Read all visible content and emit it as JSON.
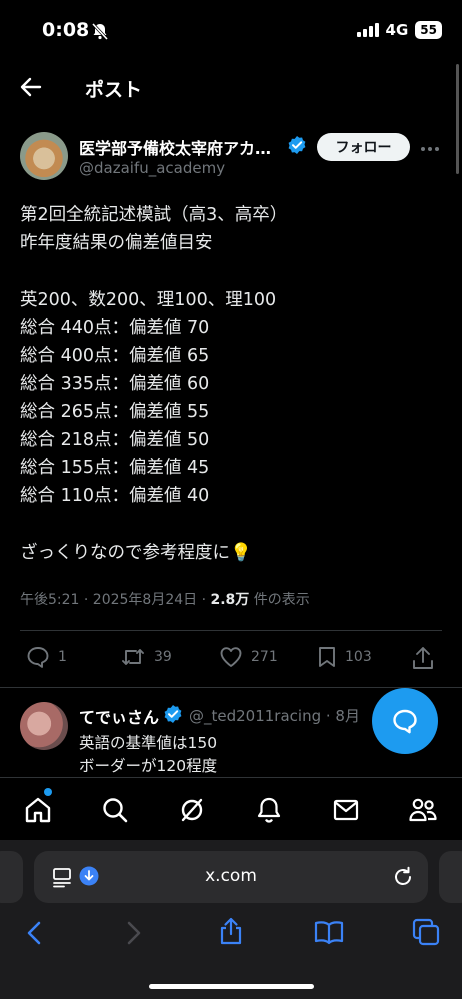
{
  "status": {
    "time": "0:08",
    "network": "4G",
    "battery": "55"
  },
  "header": {
    "title": "ポスト"
  },
  "author": {
    "name": "医学部予備校太宰府アカ…",
    "handle": "@dazaifu_academy",
    "follow_label": "フォロー"
  },
  "tweet": {
    "lines": [
      "第2回全統記述模試（高3、高卒）",
      "昨年度結果の偏差値目安",
      "",
      "英200、数200、理100、理100",
      "総合 440点：偏差値 70",
      "総合 400点：偏差値 65",
      "総合 335点：偏差値 60",
      "総合 265点：偏差値 55",
      "総合 218点：偏差値 50",
      "総合 155点：偏差値 45",
      "総合 110点：偏差値 40",
      "",
      "ざっくりなので参考程度に💡"
    ],
    "timestamp": "午後5:21 · 2025年8月24日 · ",
    "views_count": "2.8万",
    "views_label": " 件の表示"
  },
  "actions": {
    "replies": "1",
    "reposts": "39",
    "likes": "271",
    "bookmarks": "103"
  },
  "reply": {
    "name": "てでぃさん",
    "handle": "@_ted2011racing · 8月",
    "lines": [
      "英語の基準値は150",
      "ボーダーが120程度"
    ]
  },
  "browser": {
    "url": "x.com"
  },
  "colors": {
    "accent": "#1d9bf0",
    "background": "#000000",
    "muted": "#71767b"
  }
}
